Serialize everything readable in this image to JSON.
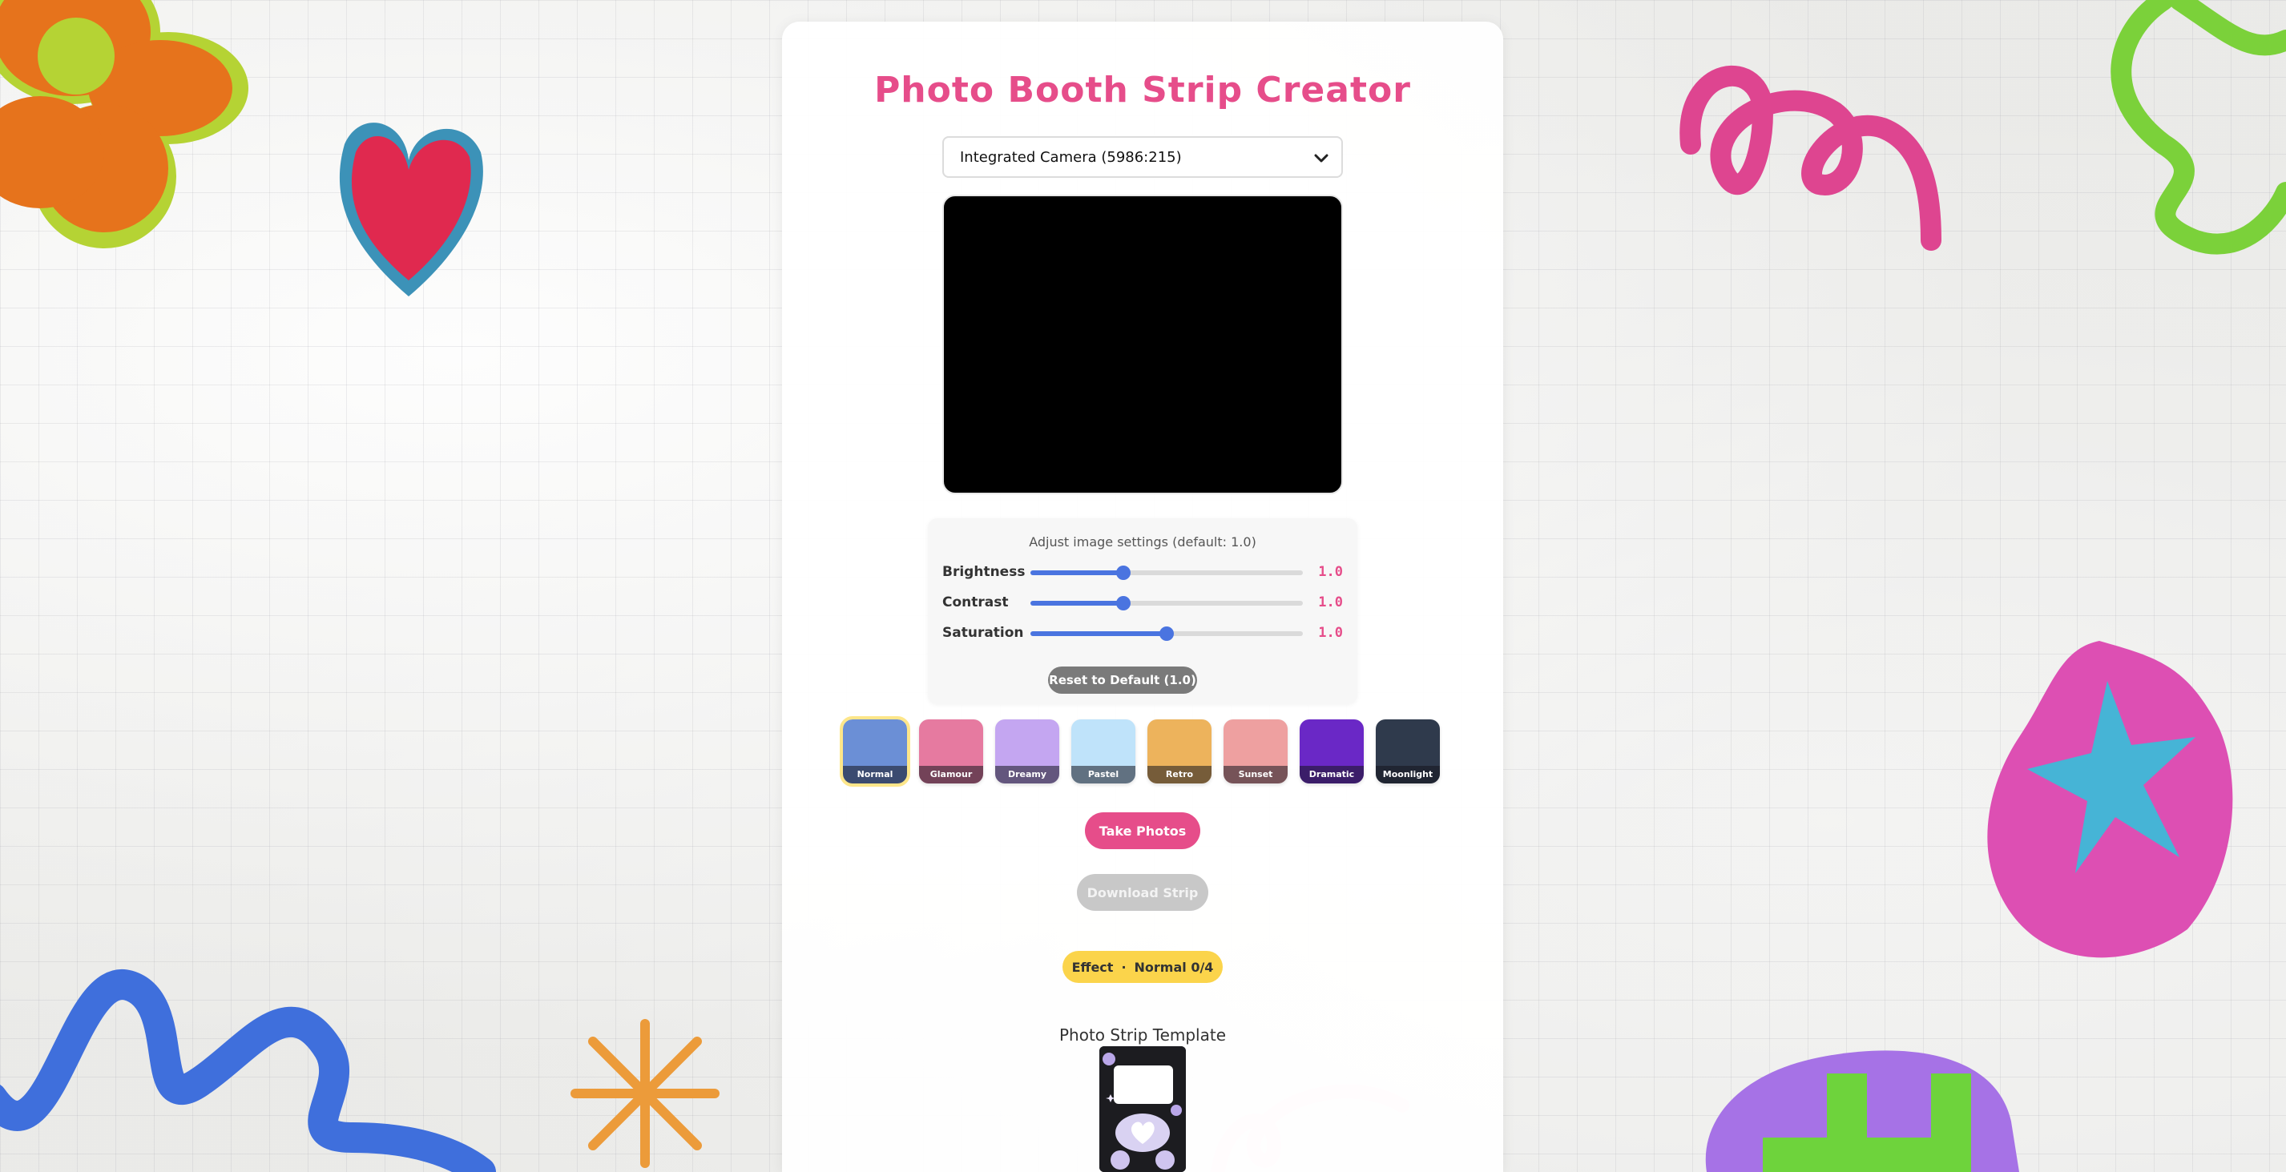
{
  "app": {
    "title": "Photo Booth Strip Creator"
  },
  "camera": {
    "selected": "Integrated Camera (5986:215)"
  },
  "adjust": {
    "title": "Adjust image settings (default: 1.0)",
    "sliders": [
      {
        "label": "Brightness",
        "value": "1.0",
        "level": 0.34
      },
      {
        "label": "Contrast",
        "value": "1.0",
        "level": 0.34
      },
      {
        "label": "Saturation",
        "value": "1.0",
        "level": 0.5
      }
    ],
    "reset_label": "Reset to Default (1.0)"
  },
  "filters": [
    {
      "label": "Normal",
      "color": "#6b8fd6",
      "selected": true
    },
    {
      "label": "Glamour",
      "color": "#e67aa0"
    },
    {
      "label": "Dreamy",
      "color": "#c4a6f1"
    },
    {
      "label": "Pastel",
      "color": "#bfe3fa"
    },
    {
      "label": "Retro",
      "color": "#edb35c"
    },
    {
      "label": "Sunset",
      "color": "#eea0a0"
    },
    {
      "label": "Dramatic",
      "color": "#6a28c6"
    },
    {
      "label": "Moonlight",
      "color": "#2f3a4c"
    }
  ],
  "actions": {
    "take_photos": "Take Photos",
    "download_strip": "Download Strip"
  },
  "effect_badge": {
    "label": "Effect",
    "separator": "·",
    "value": "Normal 0/4"
  },
  "template": {
    "title": "Photo Strip Template"
  },
  "colors": {
    "accent": "#e64d8a",
    "slider": "#4a74e0",
    "badge": "#fbd44b",
    "disabled": "#c8c8c8"
  }
}
